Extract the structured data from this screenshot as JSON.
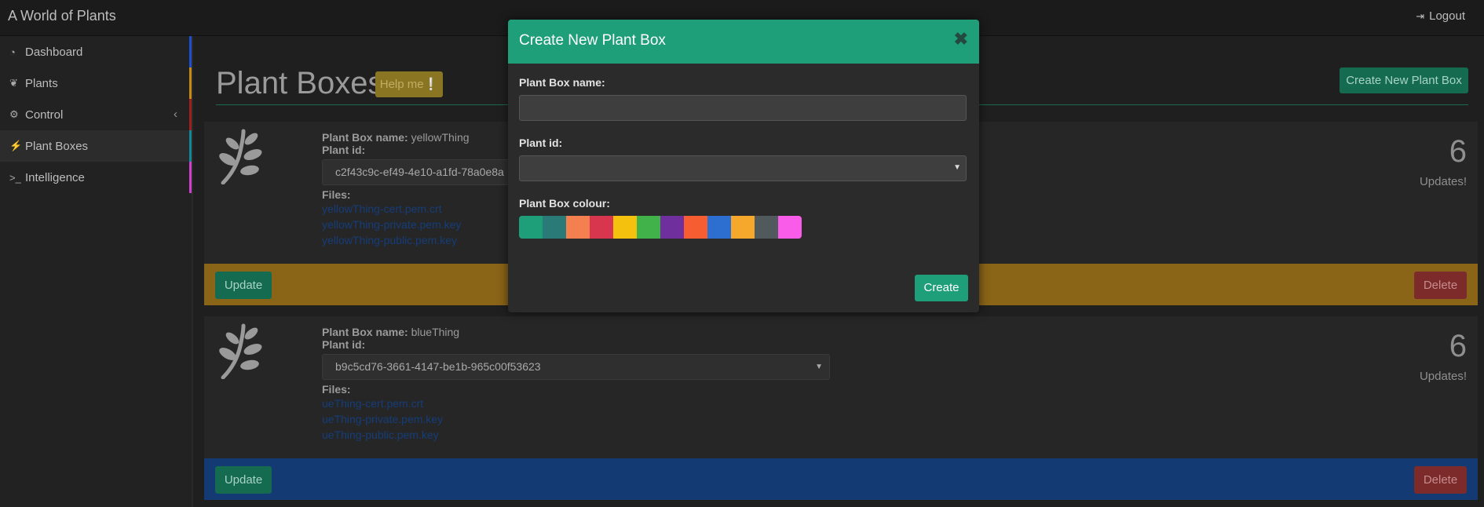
{
  "app": {
    "title": "A World of Plants",
    "logout_label": "Logout",
    "logout_icon": "sign-out-icon"
  },
  "sidebar": {
    "items": [
      {
        "label": "Dashboard",
        "icon": "dashboard-icon",
        "bar_color": "#1f4fd1"
      },
      {
        "label": "Plants",
        "icon": "leaf-icon",
        "bar_color": "#c98a12"
      },
      {
        "label": "Control",
        "icon": "gears-icon",
        "bar_color": "#a11f1f",
        "chevron": "‹"
      },
      {
        "label": "Plant Boxes",
        "icon": "plug-icon",
        "bar_color": "#12889a",
        "active": true
      },
      {
        "label": "Intelligence",
        "icon": "terminal-icon",
        "bar_color": "#d13fd1"
      }
    ]
  },
  "main": {
    "title": "Plant Boxes",
    "help_label": "Help me❕",
    "create_label": "Create New Plant Box",
    "cards": [
      {
        "name_label": "Plant Box name:",
        "name": "yellowThing",
        "plant_id_label": "Plant id:",
        "plant_id": "c2f43c9c-ef49-4e10-a1fd-78a0e8a",
        "files_label": "Files:",
        "files": [
          "yellowThing-cert.pem.crt",
          "yellowThing-private.pem.key",
          "yellowThing-public.pem.key"
        ],
        "count": "6",
        "updates_label": "Updates!",
        "footer_color": "#8a6417",
        "update_label": "Update",
        "delete_label": "Delete"
      },
      {
        "name_label": "Plant Box name:",
        "name": "blueThing",
        "plant_id_label": "Plant id:",
        "plant_id": "b9c5cd76-3661-4147-be1b-965c00f53623",
        "files_label": "Files:",
        "files": [
          "ueThing-cert.pem.crt",
          "ueThing-private.pem.key",
          "ueThing-public.pem.key"
        ],
        "count": "6",
        "updates_label": "Updates!",
        "footer_color": "#133a73",
        "update_label": "Update",
        "delete_label": "Delete"
      }
    ]
  },
  "modal": {
    "title": "Create New Plant Box",
    "close_icon": "close-icon",
    "name_label": "Plant Box name:",
    "name_value": "",
    "plant_id_label": "Plant id:",
    "plant_id_value": "",
    "colour_label": "Plant Box colour:",
    "colours": [
      "#1f9e7a",
      "#2a7a78",
      "#f47f4f",
      "#d8364e",
      "#f3c10e",
      "#41b14a",
      "#6f2f9c",
      "#f65d31",
      "#2c6fd1",
      "#f6a82d",
      "#50595c",
      "#f95ce8"
    ],
    "create_label": "Create"
  }
}
